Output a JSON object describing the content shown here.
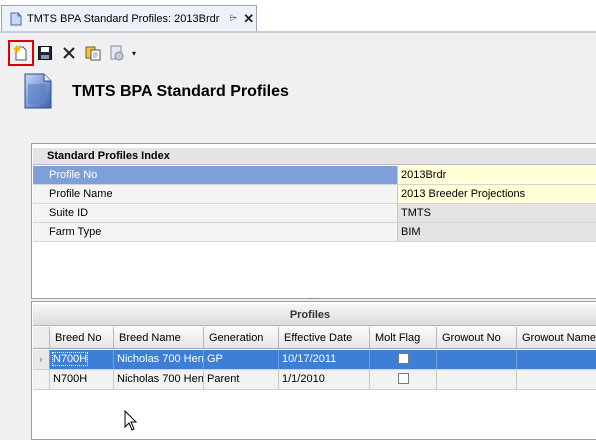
{
  "tab": {
    "title": "TMTS BPA Standard Profiles: 2013Brdr",
    "pin_glyph": "⌲",
    "close_glyph": "✕"
  },
  "toolbar": {
    "buttons": [
      "new-icon",
      "save-icon",
      "delete-icon",
      "copy-icon",
      "report-icon"
    ],
    "dropdown_glyph": "▾",
    "highlight_color": "#e00000"
  },
  "header": {
    "title": "TMTS BPA Standard Profiles"
  },
  "index": {
    "caption": "Standard Profiles Index",
    "rows": [
      {
        "label": "Profile No",
        "value": "2013Brdr"
      },
      {
        "label": "Profile Name",
        "value": "2013 Breeder Projections"
      },
      {
        "label": "Suite ID",
        "value": "TMTS"
      },
      {
        "label": "Farm Type",
        "value": "BIM"
      }
    ]
  },
  "splitter": {
    "grip": "....."
  },
  "grid": {
    "caption": "Profiles",
    "columns": [
      "Breed No",
      "Breed Name",
      "Generation",
      "Effective Date",
      "Molt Flag",
      "Growout No",
      "Growout Name"
    ],
    "rows": [
      {
        "breed_no": "N700H",
        "breed_name": "Nicholas 700 Hen",
        "generation": "GP",
        "effective_date": "10/17/2011",
        "molt_flag": false,
        "growout_no": "",
        "growout_name": ""
      },
      {
        "breed_no": "N700H",
        "breed_name": "Nicholas 700 Hen",
        "generation": "Parent",
        "effective_date": "1/1/2010",
        "molt_flag": false,
        "growout_no": "",
        "growout_name": ""
      }
    ],
    "row_indicator_glyph": "›"
  },
  "colors": {
    "selected_row": "#3d7fd6",
    "selected_prop": "#7f9fd8",
    "editable_value": "#ffffd8"
  }
}
